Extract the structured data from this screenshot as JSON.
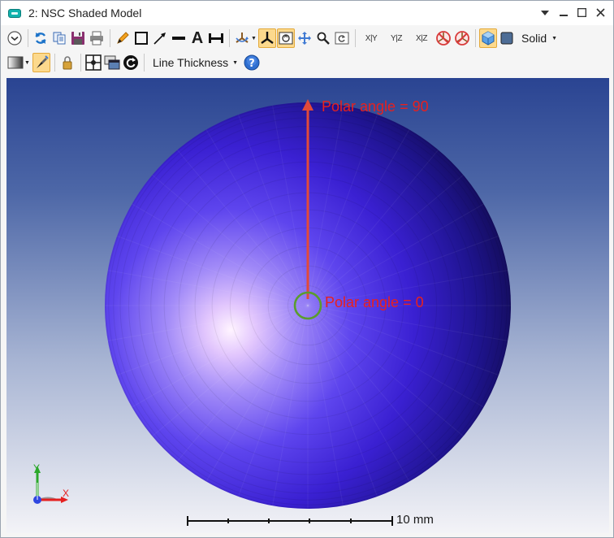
{
  "window": {
    "title": "2: NSC Shaded Model",
    "controls": [
      "dropdown-caret-icon",
      "minimize-icon",
      "maximize-icon",
      "close-icon"
    ]
  },
  "toolbar": {
    "display_mode": "Solid",
    "line_thickness_label": "Line Thickness",
    "axis_views": {
      "xy": "X|Y",
      "yz": "Y|Z",
      "xz": "X|Z"
    },
    "text_tool_label": "A"
  },
  "viewport": {
    "annotation_top": "Polar angle = 90",
    "annotation_center": "Polar angle = 0",
    "scale_bar_label": "10 mm",
    "triad": {
      "x": "X",
      "y": "Y"
    },
    "colors": {
      "arrow": "#e14a3a",
      "center_ring": "#5a9c2e",
      "annotation_text": "#e8201e",
      "sphere_bright": "#fff2ff",
      "sphere_mid": "#5544ee",
      "sphere_dark": "#0d0938"
    }
  }
}
